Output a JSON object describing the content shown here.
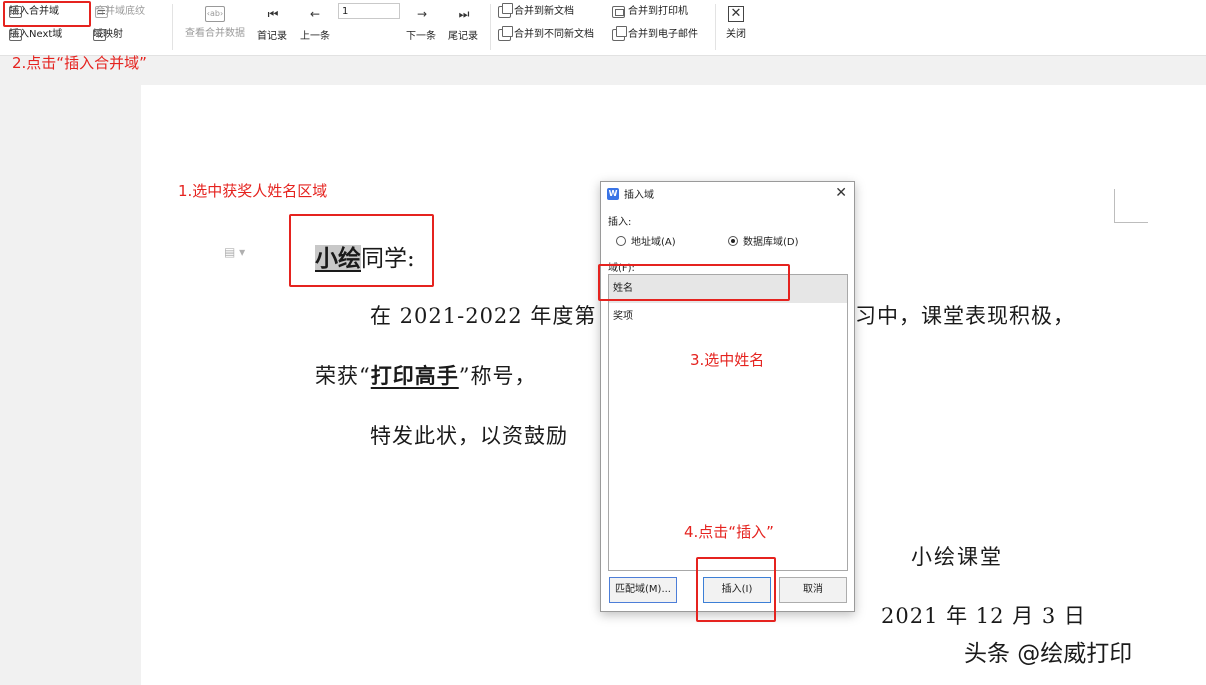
{
  "ribbon": {
    "insert_merge_field": "插入合并域",
    "merge_field_shading": "合并域底纹",
    "insert_next_field": "插入Next域",
    "field_mapping": "域映射",
    "view_merge_data": "查看合并数据",
    "first_record": "首记录",
    "prev_record": "上一条",
    "record_number": "1",
    "next_record": "下一条",
    "last_record": "尾记录",
    "merge_to_new_doc": "合并到新文档",
    "merge_to_different_docs": "合并到不同新文档",
    "merge_to_printer": "合并到打印机",
    "merge_to_email": "合并到电子邮件",
    "close": "关闭",
    "view_data_icon_text": "‹ab›",
    "close_icon_glyph": "✕"
  },
  "annotations": {
    "step1": "1.选中获奖人姓名区域",
    "step2": "2.点击“插入合并域”",
    "step3": "3.选中姓名",
    "step4": "4.点击“插入”",
    "color": "#e5231f"
  },
  "document": {
    "name_field": "小绘",
    "salutation_suffix": "同学:",
    "p1_left": "在 2021-2022 年度第",
    "p1_right": "习中，课堂表现积极，",
    "p2_prefix": "荣获“",
    "p2_title": "打印高手",
    "p2_suffix": "”称号，",
    "p3": "特发此状，以资鼓励",
    "signature": "小绘课堂",
    "date": "2021 年 12 月 3 日"
  },
  "dialog": {
    "app_icon": "W",
    "title": "插入域",
    "insert_label": "插入:",
    "radio_address": "地址域(A)",
    "radio_database": "数据库域(D)",
    "selected_radio": "数据库域(D)",
    "fields_label": "域(F):",
    "fields": [
      "姓名",
      "奖项"
    ],
    "selected_field": "姓名",
    "btn_match": "匹配域(M)...",
    "btn_insert": "插入(I)",
    "btn_cancel": "取消"
  },
  "watermark": "头条 @绘威打印",
  "colors": {
    "accent_blue": "#3a74e6",
    "annotation_red": "#e5231f"
  }
}
